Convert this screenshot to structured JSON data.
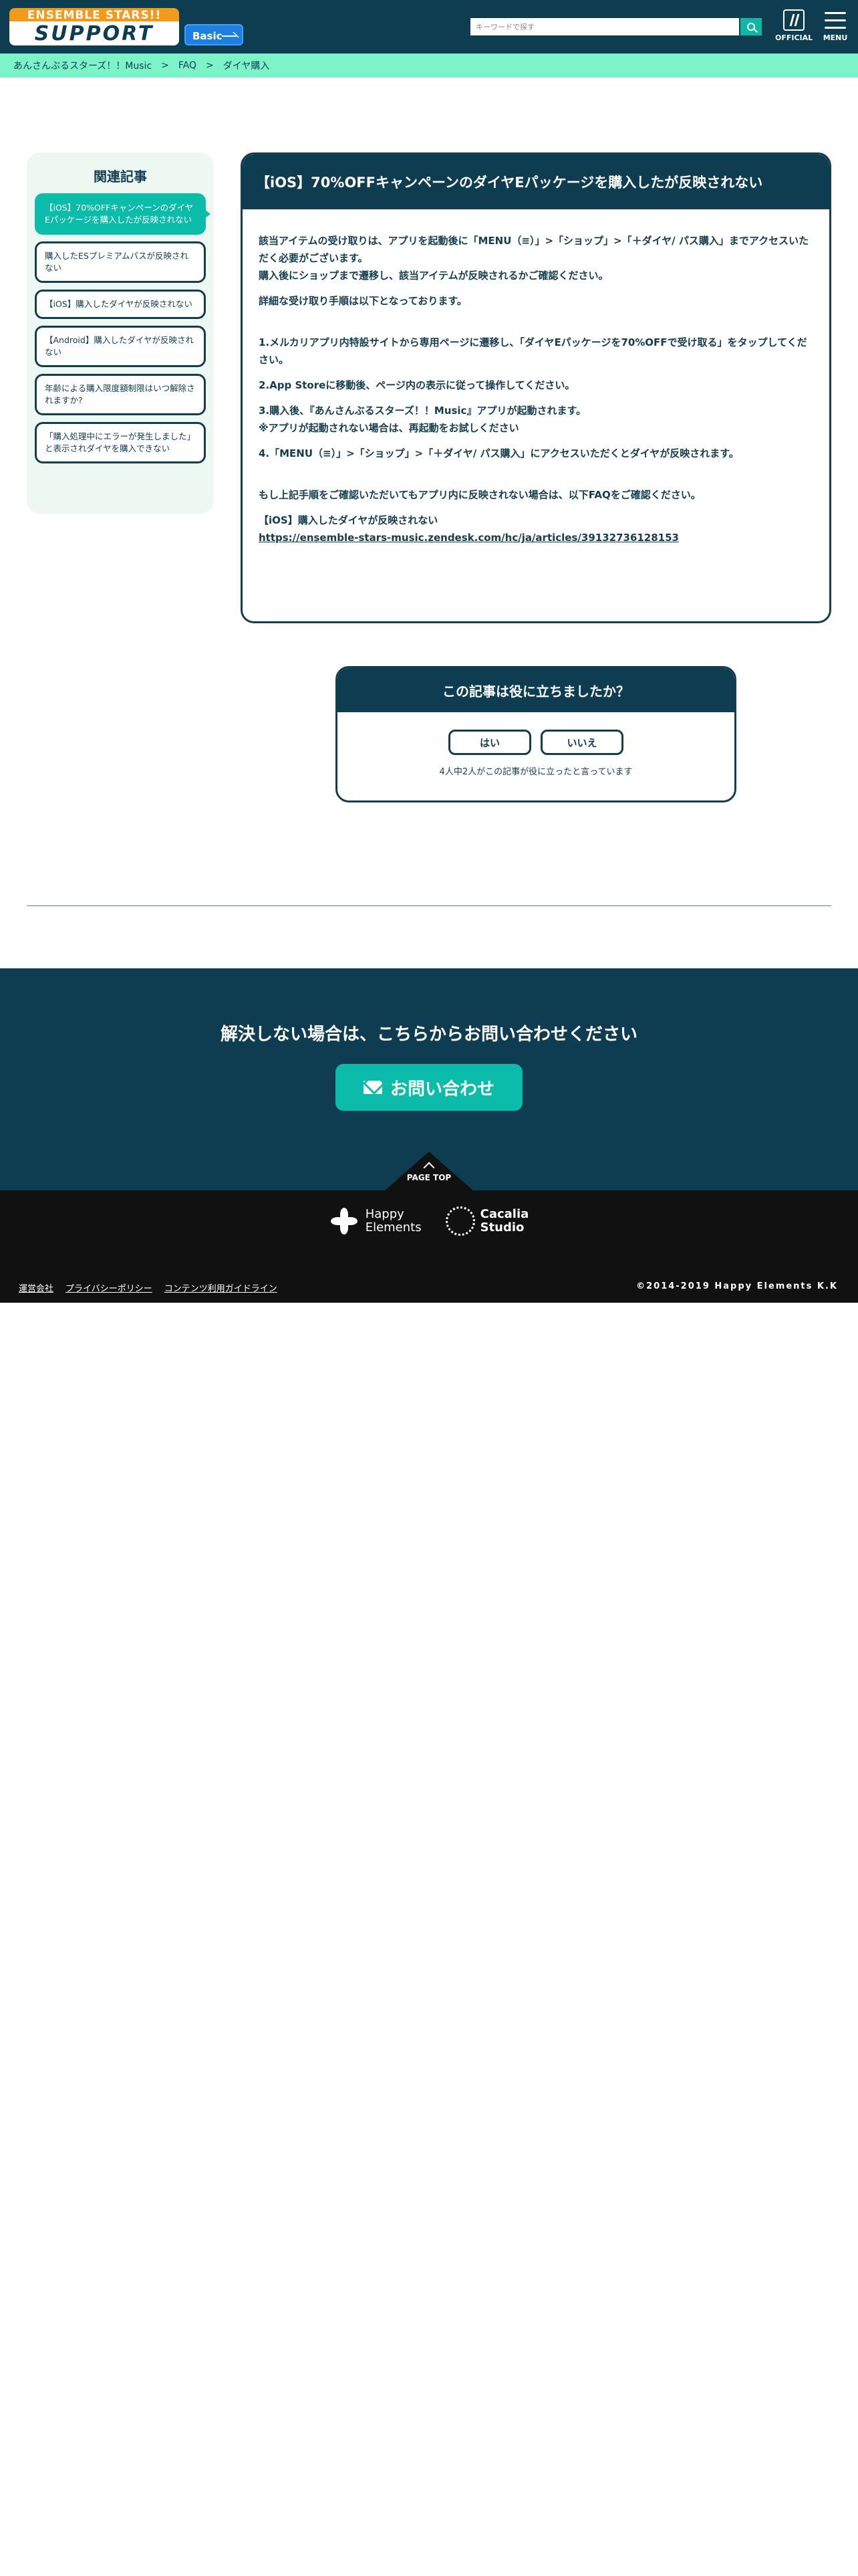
{
  "header": {
    "logo_top": "ENSEMBLE STARS!! Music",
    "logo_main": "SUPPORT",
    "badge": "Basic",
    "search_placeholder": "キーワードで探す",
    "official_label": "OFFICIAL",
    "menu_label": "MENU"
  },
  "breadcrumb": [
    "あんさんぶるスターズ！！Music",
    "FAQ",
    "ダイヤ購入"
  ],
  "breadcrumb_sep": ">",
  "sidebar": {
    "title": "関連記事",
    "items": [
      "【iOS】70%OFFキャンペーンのダイヤEパッケージを購入したが反映されない",
      "購入したESプレミアムパスが反映されない",
      "【iOS】購入したダイヤが反映されない",
      "【Android】購入したダイヤが反映されない",
      "年齢による購入限度額制限はいつ解除されますか?",
      "「購入処理中にエラーが発生しました」と表示されダイヤを購入できない"
    ]
  },
  "article": {
    "title": "【iOS】70%OFFキャンペーンのダイヤEパッケージを購入したが反映されない",
    "p1": "該当アイテムの受け取りは、アプリを起動後に「MENU（≡）」>「ショップ」>「＋ダイヤ/ パス購入」までアクセスいただく必要がございます。",
    "p2": "購入後にショップまで遷移し、該当アイテムが反映されるかご確認ください。",
    "p3": "詳細な受け取り手順は以下となっております。",
    "step1": "1.メルカリアプリ内特設サイトから専用ページに遷移し、「ダイヤEパッケージを70%OFFで受け取る」をタップしてください。",
    "step2": "2.App Storeに移動後、ページ内の表示に従って操作してください。",
    "step3": "3.購入後、『あんさんぶるスターズ！！Music』アプリが起動されます。",
    "step3_note": "※アプリが起動されない場合は、再起動をお試しください",
    "step4": "4.「MENU（≡）」>「ショップ」>「＋ダイヤ/ パス購入」にアクセスいただくとダイヤが反映されます。",
    "p4": "もし上記手順をご確認いただいてもアプリ内に反映されない場合は、以下FAQをご確認ください。",
    "link_title": "【iOS】購入したダイヤが反映されない",
    "link_url": "https://ensemble-stars-music.zendesk.com/hc/ja/articles/39132736128153"
  },
  "feedback": {
    "question": "この記事は役に立ちましたか？",
    "yes": "はい",
    "no": "いいえ",
    "note": "4人中2人がこの記事が役に立ったと言っています"
  },
  "contact": {
    "title": "解決しない場合は、こちらからお問い合わせください",
    "button": "お問い合わせ"
  },
  "pagetop": "PAGE TOP",
  "footer": {
    "he_logo_line1": "Happy",
    "he_logo_line2": "Elements",
    "cs_logo_line1": "Cacalia",
    "cs_logo_line2": "Studio",
    "links": [
      "運営会社",
      "プライバシーポリシー",
      "コンテンツ利用ガイドライン"
    ],
    "copyright": "©2014-2019 Happy Elements K.K"
  },
  "colors": {
    "navy": "#0e3d52",
    "teal": "#0bbcab",
    "mint": "#7cf3c9",
    "orange": "#f29a1c",
    "blue": "#1d7fe0"
  }
}
